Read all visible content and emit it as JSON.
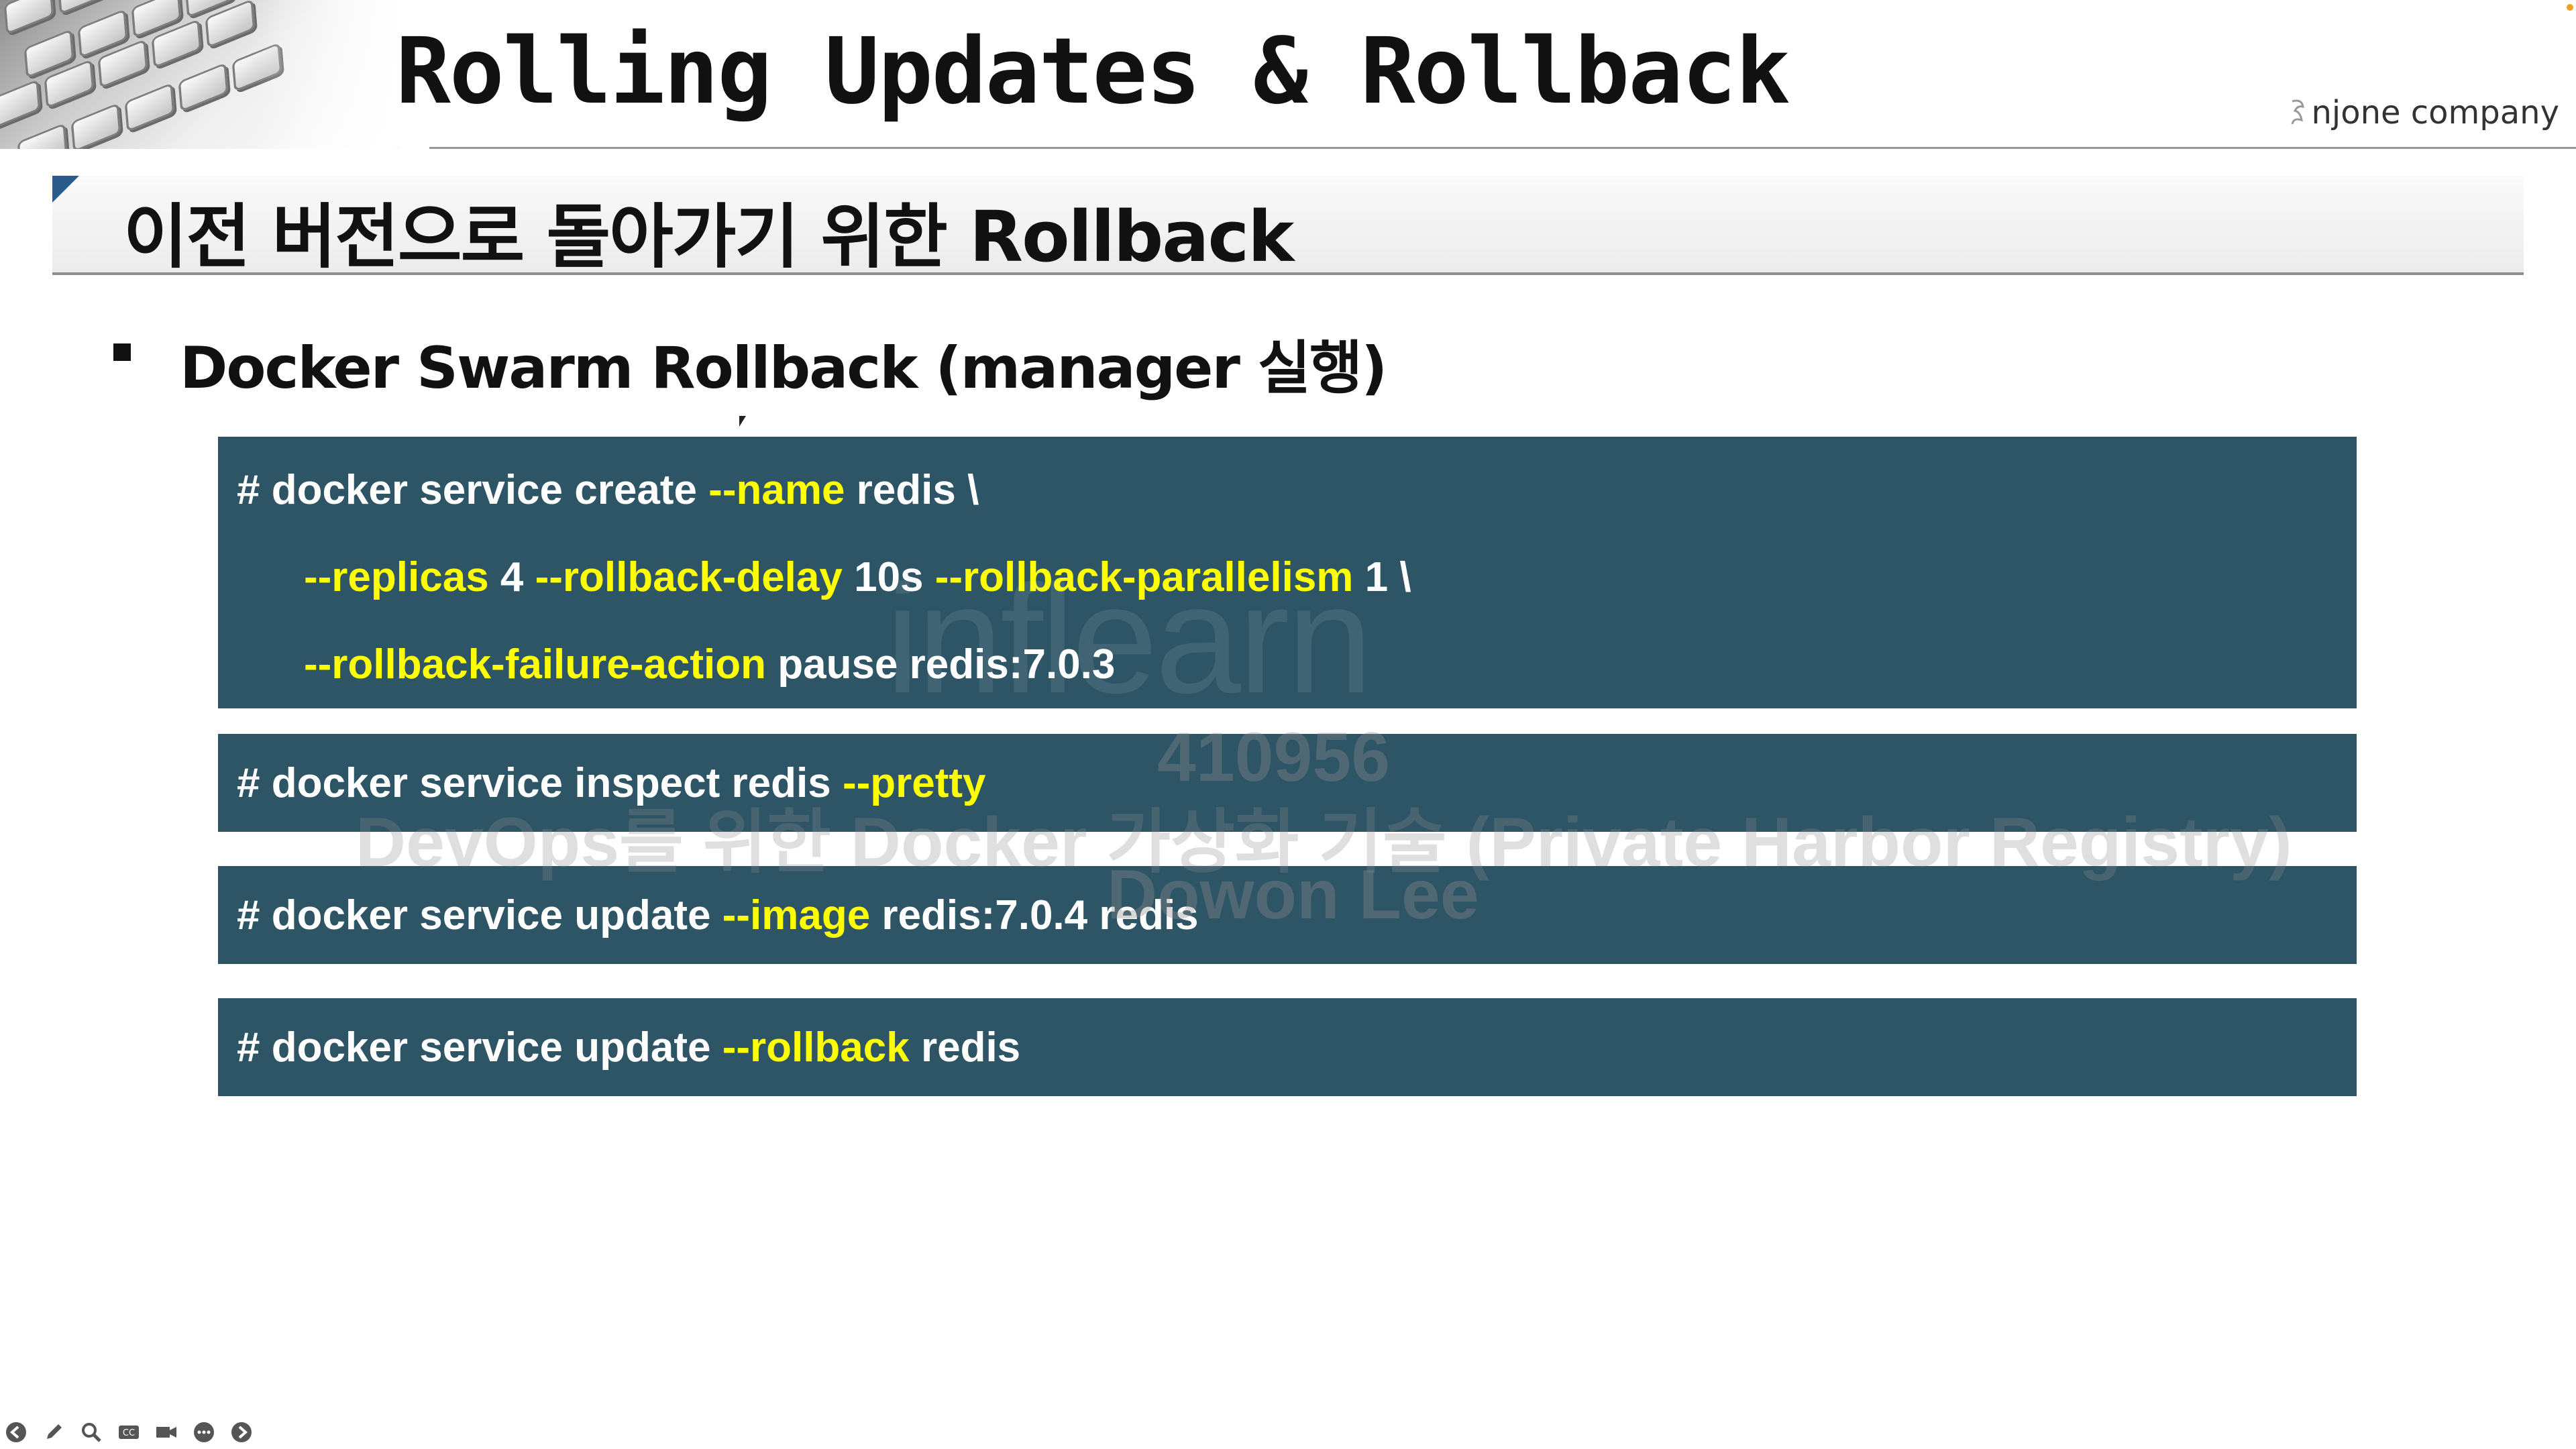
{
  "header": {
    "title": "Rolling Updates & Rollback",
    "brand": "njone company"
  },
  "section": {
    "title": "이전 버전으로 돌아가기 위한 Rollback"
  },
  "bullet": {
    "text": "Docker Swarm Rollback (manager 실행)"
  },
  "code_blocks": [
    {
      "lines": [
        {
          "parts": [
            {
              "t": "# docker service create ",
              "k": false
            },
            {
              "t": "--name",
              "k": true
            },
            {
              "t": " redis \\",
              "k": false
            }
          ]
        },
        {
          "parts": [
            {
              "t": "--replicas",
              "k": true
            },
            {
              "t": " 4 ",
              "k": false
            },
            {
              "t": "--rollback-delay",
              "k": true
            },
            {
              "t": " 10s ",
              "k": false
            },
            {
              "t": "--rollback-parallelism",
              "k": true
            },
            {
              "t": " 1 \\",
              "k": false
            }
          ]
        },
        {
          "parts": [
            {
              "t": "--rollback-failure-action",
              "k": true
            },
            {
              "t": " pause redis:7.0.3",
              "k": false
            }
          ]
        }
      ]
    },
    {
      "lines": [
        {
          "parts": [
            {
              "t": "# docker service inspect redis ",
              "k": false
            },
            {
              "t": "--pretty",
              "k": true
            }
          ]
        }
      ]
    },
    {
      "lines": [
        {
          "parts": [
            {
              "t": "# docker service update ",
              "k": false
            },
            {
              "t": "--image",
              "k": true
            },
            {
              "t": " redis:7.0.4 redis",
              "k": false
            }
          ]
        }
      ]
    },
    {
      "lines": [
        {
          "parts": [
            {
              "t": "# docker service update ",
              "k": false
            },
            {
              "t": "--rollback",
              "k": true
            },
            {
              "t": " redis",
              "k": false
            }
          ]
        }
      ]
    }
  ],
  "watermark": {
    "logo": "inflearn",
    "id": "410956",
    "course": "DevOps를 위한 Docker 가상화 기술 (Private Harbor Registry)",
    "author": "Dowon Lee"
  },
  "toolbar": [
    {
      "icon": "back-arrow-icon"
    },
    {
      "icon": "pen-icon"
    },
    {
      "icon": "zoom-icon"
    },
    {
      "icon": "captions-icon"
    },
    {
      "icon": "camera-icon"
    },
    {
      "icon": "more-icon"
    },
    {
      "icon": "forward-arrow-icon"
    }
  ],
  "colors": {
    "code_bg": "#2e5566",
    "keyword": "#ffff00",
    "code_text": "#ffffff",
    "section_corner": "#2a5a8c"
  }
}
